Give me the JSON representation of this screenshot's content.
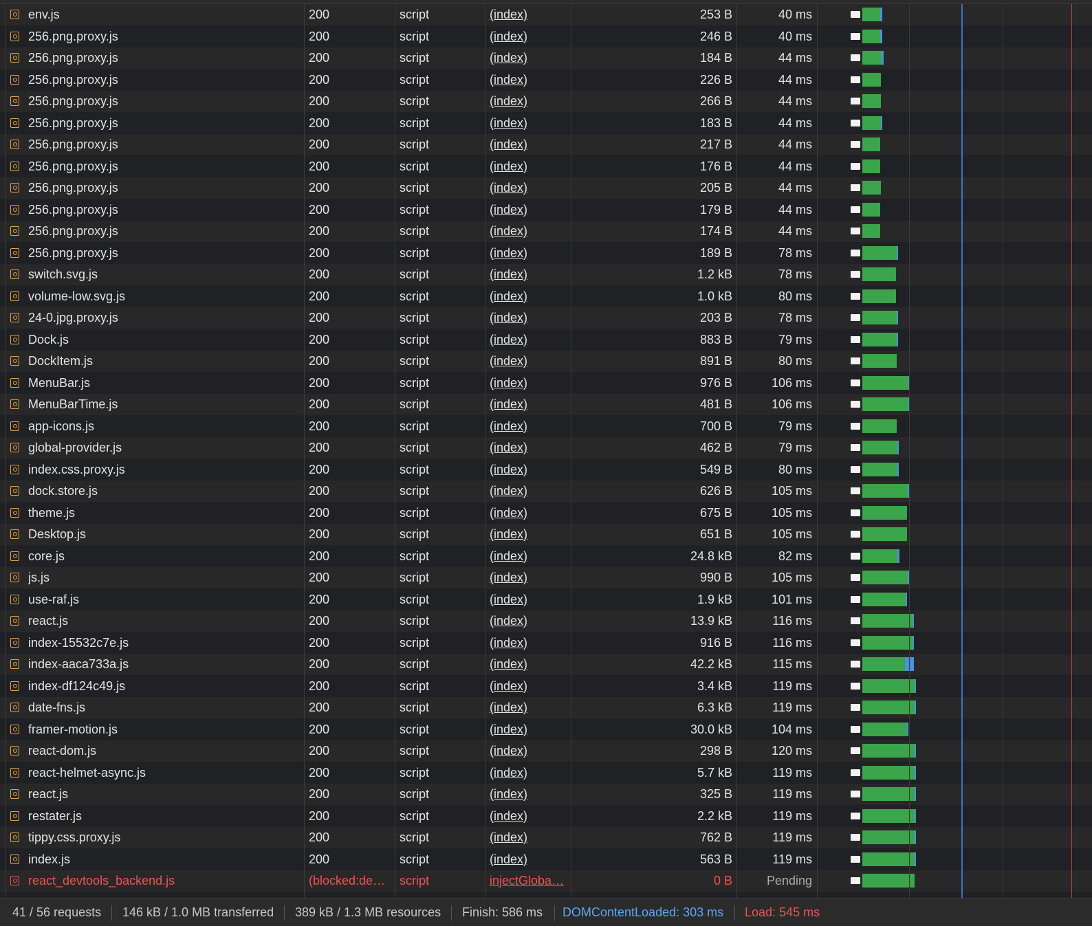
{
  "requests": [
    {
      "name": "env.js",
      "status": "200",
      "type": "script",
      "initiator": "(index)",
      "size": "253 B",
      "time": "40 ms",
      "wf": {
        "start": 0.0,
        "recv": 26,
        "tail": 3
      }
    },
    {
      "name": "256.png.proxy.js",
      "status": "200",
      "type": "script",
      "initiator": "(index)",
      "size": "246 B",
      "time": "40 ms",
      "wf": {
        "start": 0.0,
        "recv": 26,
        "tail": 3
      }
    },
    {
      "name": "256.png.proxy.js",
      "status": "200",
      "type": "script",
      "initiator": "(index)",
      "size": "184 B",
      "time": "44 ms",
      "wf": {
        "start": 0.0,
        "recv": 28,
        "tail": 3
      }
    },
    {
      "name": "256.png.proxy.js",
      "status": "200",
      "type": "script",
      "initiator": "(index)",
      "size": "226 B",
      "time": "44 ms",
      "wf": {
        "start": 0.0,
        "recv": 27,
        "tail": 0
      }
    },
    {
      "name": "256.png.proxy.js",
      "status": "200",
      "type": "script",
      "initiator": "(index)",
      "size": "266 B",
      "time": "44 ms",
      "wf": {
        "start": 0.0,
        "recv": 27,
        "tail": 0
      }
    },
    {
      "name": "256.png.proxy.js",
      "status": "200",
      "type": "script",
      "initiator": "(index)",
      "size": "183 B",
      "time": "44 ms",
      "wf": {
        "start": 0.0,
        "recv": 27,
        "tail": 2
      }
    },
    {
      "name": "256.png.proxy.js",
      "status": "200",
      "type": "script",
      "initiator": "(index)",
      "size": "217 B",
      "time": "44 ms",
      "wf": {
        "start": 0.0,
        "recv": 26,
        "tail": 0
      }
    },
    {
      "name": "256.png.proxy.js",
      "status": "200",
      "type": "script",
      "initiator": "(index)",
      "size": "176 B",
      "time": "44 ms",
      "wf": {
        "start": 0.0,
        "recv": 26,
        "tail": 0
      }
    },
    {
      "name": "256.png.proxy.js",
      "status": "200",
      "type": "script",
      "initiator": "(index)",
      "size": "205 B",
      "time": "44 ms",
      "wf": {
        "start": 0.0,
        "recv": 27,
        "tail": 0
      }
    },
    {
      "name": "256.png.proxy.js",
      "status": "200",
      "type": "script",
      "initiator": "(index)",
      "size": "179 B",
      "time": "44 ms",
      "wf": {
        "start": 0.0,
        "recv": 26,
        "tail": 0
      }
    },
    {
      "name": "256.png.proxy.js",
      "status": "200",
      "type": "script",
      "initiator": "(index)",
      "size": "174 B",
      "time": "44 ms",
      "wf": {
        "start": 0.0,
        "recv": 26,
        "tail": 0
      }
    },
    {
      "name": "256.png.proxy.js",
      "status": "200",
      "type": "script",
      "initiator": "(index)",
      "size": "189 B",
      "time": "78 ms",
      "wf": {
        "start": 0.0,
        "recv": 50,
        "tail": 2
      }
    },
    {
      "name": "switch.svg.js",
      "status": "200",
      "type": "script",
      "initiator": "(index)",
      "size": "1.2 kB",
      "time": "78 ms",
      "wf": {
        "start": 0.0,
        "recv": 49,
        "tail": 0
      }
    },
    {
      "name": "volume-low.svg.js",
      "status": "200",
      "type": "script",
      "initiator": "(index)",
      "size": "1.0 kB",
      "time": "80 ms",
      "wf": {
        "start": 0.0,
        "recv": 49,
        "tail": 0
      }
    },
    {
      "name": "24-0.jpg.proxy.js",
      "status": "200",
      "type": "script",
      "initiator": "(index)",
      "size": "203 B",
      "time": "78 ms",
      "wf": {
        "start": 0.0,
        "recv": 50,
        "tail": 2
      }
    },
    {
      "name": "Dock.js",
      "status": "200",
      "type": "script",
      "initiator": "(index)",
      "size": "883 B",
      "time": "79 ms",
      "wf": {
        "start": 0.0,
        "recv": 50,
        "tail": 2
      }
    },
    {
      "name": "DockItem.js",
      "status": "200",
      "type": "script",
      "initiator": "(index)",
      "size": "891 B",
      "time": "80 ms",
      "wf": {
        "start": 0.0,
        "recv": 50,
        "tail": 0
      }
    },
    {
      "name": "MenuBar.js",
      "status": "200",
      "type": "script",
      "initiator": "(index)",
      "size": "976 B",
      "time": "106 ms",
      "wf": {
        "start": 0.0,
        "recv": 67,
        "tail": 2
      }
    },
    {
      "name": "MenuBarTime.js",
      "status": "200",
      "type": "script",
      "initiator": "(index)",
      "size": "481 B",
      "time": "106 ms",
      "wf": {
        "start": 0.0,
        "recv": 67,
        "tail": 2
      }
    },
    {
      "name": "app-icons.js",
      "status": "200",
      "type": "script",
      "initiator": "(index)",
      "size": "700 B",
      "time": "79 ms",
      "wf": {
        "start": 0.0,
        "recv": 50,
        "tail": 0
      }
    },
    {
      "name": "global-provider.js",
      "status": "200",
      "type": "script",
      "initiator": "(index)",
      "size": "462 B",
      "time": "79 ms",
      "wf": {
        "start": 0.0,
        "recv": 51,
        "tail": 2
      }
    },
    {
      "name": "index.css.proxy.js",
      "status": "200",
      "type": "script",
      "initiator": "(index)",
      "size": "549 B",
      "time": "80 ms",
      "wf": {
        "start": 0.0,
        "recv": 51,
        "tail": 2
      }
    },
    {
      "name": "dock.store.js",
      "status": "200",
      "type": "script",
      "initiator": "(index)",
      "size": "626 B",
      "time": "105 ms",
      "wf": {
        "start": 0.0,
        "recv": 66,
        "tail": 2
      }
    },
    {
      "name": "theme.js",
      "status": "200",
      "type": "script",
      "initiator": "(index)",
      "size": "675 B",
      "time": "105 ms",
      "wf": {
        "start": 0.0,
        "recv": 65,
        "tail": 0
      }
    },
    {
      "name": "Desktop.js",
      "status": "200",
      "type": "script",
      "initiator": "(index)",
      "size": "651 B",
      "time": "105 ms",
      "wf": {
        "start": 0.0,
        "recv": 65,
        "tail": 0
      }
    },
    {
      "name": "core.js",
      "status": "200",
      "type": "script",
      "initiator": "(index)",
      "size": "24.8 kB",
      "time": "82 ms",
      "wf": {
        "start": 0.0,
        "recv": 51,
        "tail": 3
      }
    },
    {
      "name": "js.js",
      "status": "200",
      "type": "script",
      "initiator": "(index)",
      "size": "990 B",
      "time": "105 ms",
      "wf": {
        "start": 0.0,
        "recv": 66,
        "tail": 2
      }
    },
    {
      "name": "use-raf.js",
      "status": "200",
      "type": "script",
      "initiator": "(index)",
      "size": "1.9 kB",
      "time": "101 ms",
      "wf": {
        "start": 0.0,
        "recv": 63,
        "tail": 2
      }
    },
    {
      "name": "react.js",
      "status": "200",
      "type": "script",
      "initiator": "(index)",
      "size": "13.9 kB",
      "time": "116 ms",
      "wf": {
        "start": 0.0,
        "recv": 73,
        "tail": 2
      }
    },
    {
      "name": "index-15532c7e.js",
      "status": "200",
      "type": "script",
      "initiator": "(index)",
      "size": "916 B",
      "time": "116 ms",
      "wf": {
        "start": 0.0,
        "recv": 73,
        "tail": 2
      }
    },
    {
      "name": "index-aaca733a.js",
      "status": "200",
      "type": "script",
      "initiator": "(index)",
      "size": "42.2 kB",
      "time": "115 ms",
      "wf": {
        "start": 0.0,
        "recv": 62,
        "tail": 13
      }
    },
    {
      "name": "index-df124c49.js",
      "status": "200",
      "type": "script",
      "initiator": "(index)",
      "size": "3.4 kB",
      "time": "119 ms",
      "wf": {
        "start": 0.0,
        "recv": 76,
        "tail": 2
      }
    },
    {
      "name": "date-fns.js",
      "status": "200",
      "type": "script",
      "initiator": "(index)",
      "size": "6.3 kB",
      "time": "119 ms",
      "wf": {
        "start": 0.0,
        "recv": 76,
        "tail": 2
      }
    },
    {
      "name": "framer-motion.js",
      "status": "200",
      "type": "script",
      "initiator": "(index)",
      "size": "30.0 kB",
      "time": "104 ms",
      "wf": {
        "start": 0.0,
        "recv": 65,
        "tail": 2
      }
    },
    {
      "name": "react-dom.js",
      "status": "200",
      "type": "script",
      "initiator": "(index)",
      "size": "298 B",
      "time": "120 ms",
      "wf": {
        "start": 0.0,
        "recv": 76,
        "tail": 2
      }
    },
    {
      "name": "react-helmet-async.js",
      "status": "200",
      "type": "script",
      "initiator": "(index)",
      "size": "5.7 kB",
      "time": "119 ms",
      "wf": {
        "start": 0.0,
        "recv": 76,
        "tail": 2
      }
    },
    {
      "name": "react.js",
      "status": "200",
      "type": "script",
      "initiator": "(index)",
      "size": "325 B",
      "time": "119 ms",
      "wf": {
        "start": 0.0,
        "recv": 76,
        "tail": 2
      }
    },
    {
      "name": "restater.js",
      "status": "200",
      "type": "script",
      "initiator": "(index)",
      "size": "2.2 kB",
      "time": "119 ms",
      "wf": {
        "start": 0.0,
        "recv": 76,
        "tail": 2
      }
    },
    {
      "name": "tippy.css.proxy.js",
      "status": "200",
      "type": "script",
      "initiator": "(index)",
      "size": "762 B",
      "time": "119 ms",
      "wf": {
        "start": 0.0,
        "recv": 76,
        "tail": 2
      }
    },
    {
      "name": "index.js",
      "status": "200",
      "type": "script",
      "initiator": "(index)",
      "size": "563 B",
      "time": "119 ms",
      "wf": {
        "start": 0.0,
        "recv": 76,
        "tail": 2
      }
    },
    {
      "name": "react_devtools_backend.js",
      "status": "(blocked:de…",
      "type": "script",
      "initiator": "injectGloba…",
      "size": "0 B",
      "time": "Pending",
      "failed": true,
      "wf": {
        "start": 0.0,
        "recv": 76,
        "tail": 0
      }
    }
  ],
  "status_bar": {
    "requests": "41 / 56 requests",
    "transferred": "146 kB / 1.0 MB transferred",
    "resources": "389 kB / 1.3 MB resources",
    "finish": "Finish: 586 ms",
    "dom_content_loaded": "DOMContentLoaded: 303 ms",
    "load": "Load: 545 ms"
  },
  "colors": {
    "waiting": "#f2f2f2",
    "download": "#3aa54a",
    "tail": "#4a90e2",
    "dom_content_loaded_line": "#3c6fd0",
    "load_line": "#c04040",
    "error_text": "#ef5350"
  },
  "icons": {
    "request": "script-file-icon"
  }
}
